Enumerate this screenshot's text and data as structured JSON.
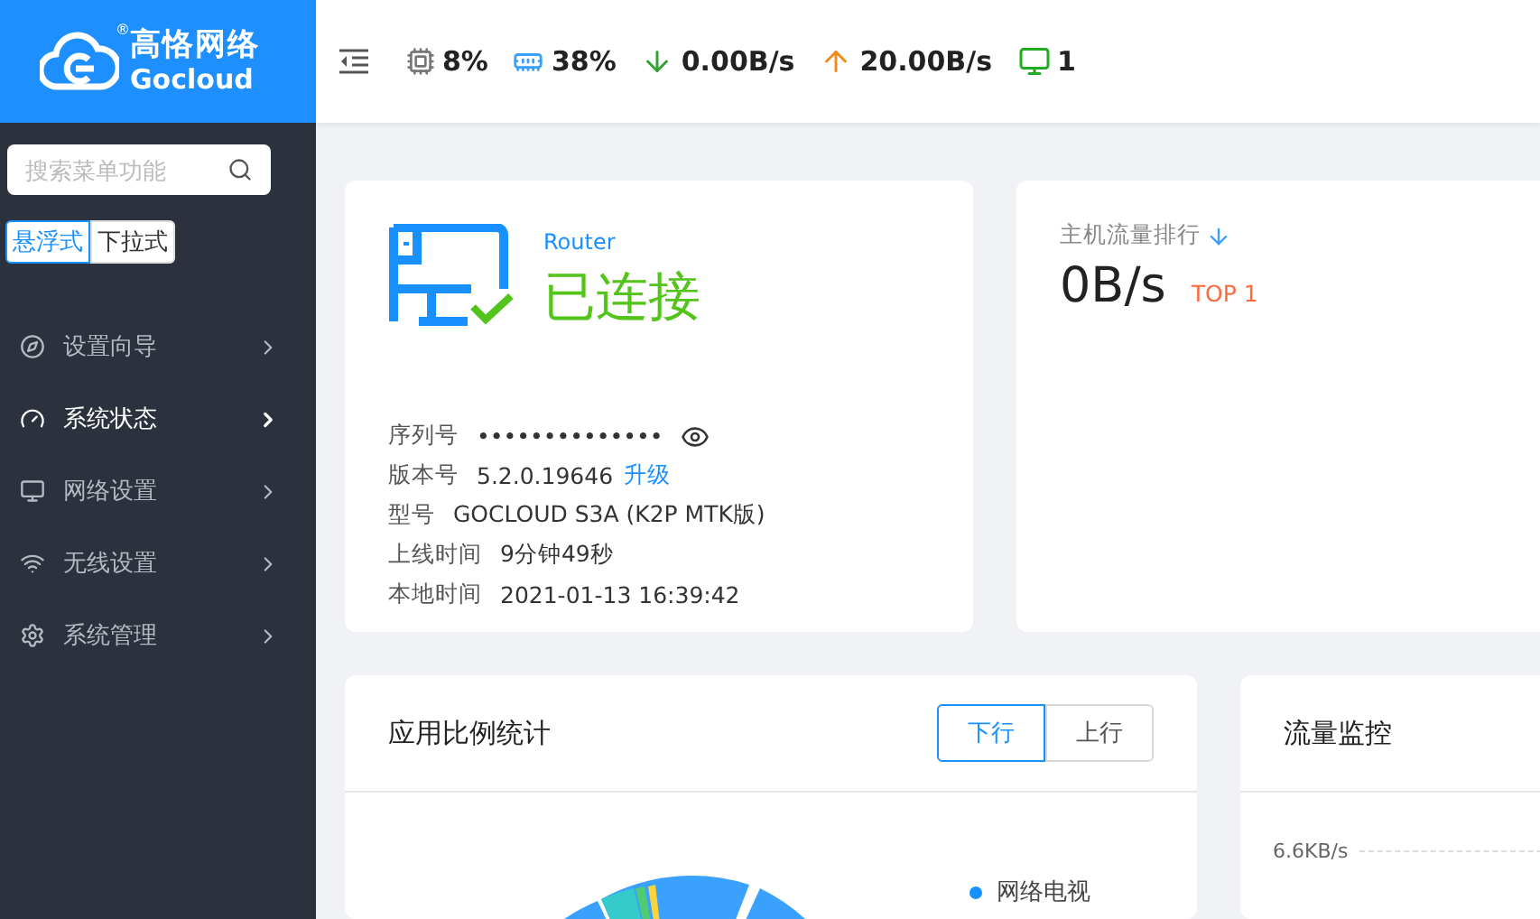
{
  "brand": {
    "name": "高恪网络",
    "sub": "Gocloud",
    "mark": "®"
  },
  "status_bar": [
    {
      "kind": "cpu",
      "value": "8%"
    },
    {
      "kind": "memory",
      "value": "38%"
    },
    {
      "kind": "download",
      "value": "0.00B/s"
    },
    {
      "kind": "upload",
      "value": "20.00B/s"
    },
    {
      "kind": "devices",
      "value": "1"
    }
  ],
  "sidebar": {
    "search": {
      "placeholder": "搜索菜单功能"
    },
    "modes": [
      {
        "label": "悬浮式",
        "selected": true
      },
      {
        "label": "下拉式",
        "selected": false
      }
    ],
    "items": [
      {
        "kind": "compass",
        "label": "设置向导",
        "selected": false
      },
      {
        "kind": "gauge",
        "label": "系统状态",
        "selected": true
      },
      {
        "kind": "monitor",
        "label": "网络设置",
        "selected": false
      },
      {
        "kind": "wifi",
        "label": "无线设置",
        "selected": false
      },
      {
        "kind": "gear",
        "label": "系统管理",
        "selected": false
      }
    ]
  },
  "router_card": {
    "device": "Router",
    "status": "已连接",
    "connected": true,
    "info": [
      {
        "label": "序列号",
        "value": "••••••••••••••",
        "kind": "secret"
      },
      {
        "label": "版本号",
        "value": "5.2.0.19646",
        "link": "升级",
        "kind": "link"
      },
      {
        "label": "型号",
        "value": "GOCLOUD S3A (K2P MTK版)",
        "kind": "text"
      },
      {
        "label": "上线时间",
        "value": "9分钟49秒",
        "kind": "text"
      },
      {
        "label": "本地时间",
        "value": "2021-01-13 16:39:42",
        "kind": "text"
      }
    ]
  },
  "ranking_card": {
    "title": "主机流量排行",
    "rate": "0B/s",
    "rank": "TOP 1"
  },
  "app_card": {
    "title": "应用比例统计",
    "tabs": [
      {
        "label": "下行",
        "selected": true
      },
      {
        "label": "上行",
        "selected": false
      }
    ],
    "legend": [
      {
        "label": "网络电视",
        "color": "#1890ff"
      }
    ]
  },
  "traffic_card": {
    "title": "流量监控",
    "axis_label": "6.6KB/s"
  }
}
